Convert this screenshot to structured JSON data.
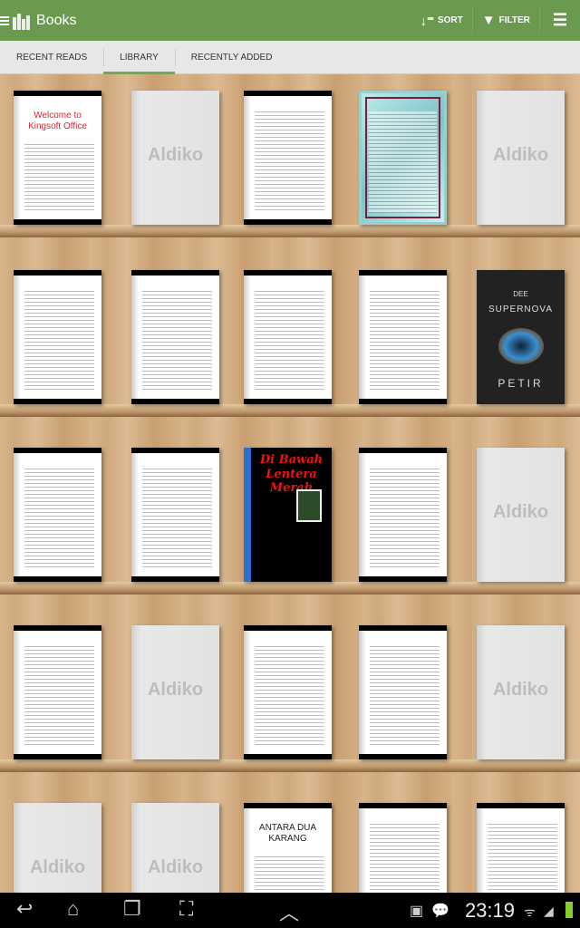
{
  "header": {
    "title": "Books",
    "sort_label": "SORT",
    "filter_label": "FILTER"
  },
  "tabs": [
    {
      "label": "RECENT READS",
      "active": false
    },
    {
      "label": "LIBRARY",
      "active": true
    },
    {
      "label": "RECENTLY ADDED",
      "active": false
    }
  ],
  "placeholder_logo": "Aldiko",
  "books": [
    {
      "type": "doc",
      "title": "Welcome to Kingsoft Office"
    },
    {
      "type": "blank"
    },
    {
      "type": "doc"
    },
    {
      "type": "teal"
    },
    {
      "type": "blank"
    },
    {
      "type": "doc"
    },
    {
      "type": "doc"
    },
    {
      "type": "doc"
    },
    {
      "type": "doc"
    },
    {
      "type": "dark",
      "title": "SUPERNOVA",
      "author": "DEE",
      "subtitle": "PETIR"
    },
    {
      "type": "doc"
    },
    {
      "type": "doc"
    },
    {
      "type": "red",
      "title": "Di Bawah Lentera Merah"
    },
    {
      "type": "doc"
    },
    {
      "type": "blank"
    },
    {
      "type": "doc"
    },
    {
      "type": "blank"
    },
    {
      "type": "doc"
    },
    {
      "type": "doc"
    },
    {
      "type": "blank"
    },
    {
      "type": "blank"
    },
    {
      "type": "blank"
    },
    {
      "type": "doc",
      "title": "ANTARA DUA KARANG"
    },
    {
      "type": "doc"
    },
    {
      "type": "doc"
    }
  ],
  "status": {
    "time": "23:19"
  },
  "colors": {
    "header": "#6a9a4f",
    "tab_indicator": "#6aac4f"
  }
}
